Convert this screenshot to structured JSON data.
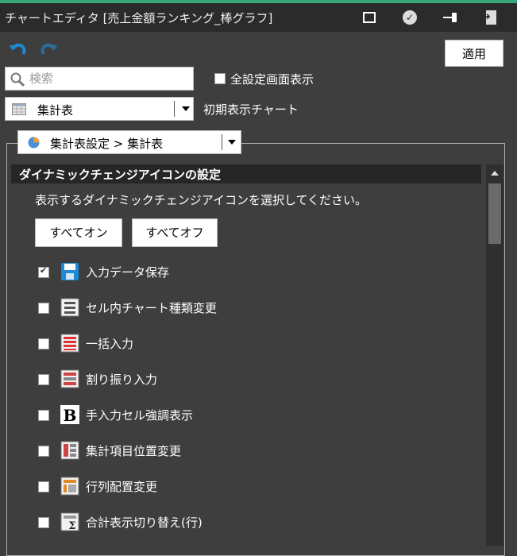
{
  "window": {
    "title": "チャートエディタ [売上金額ランキング_棒グラフ]"
  },
  "toolbar": {
    "apply_label": "適用"
  },
  "search": {
    "placeholder": "検索"
  },
  "full_settings": {
    "label": "全設定画面表示",
    "checked": false
  },
  "chart_select": {
    "value": "集計表",
    "label": "初期表示チャート"
  },
  "settings_select": {
    "value": "集計表設定 > 集計表"
  },
  "section": {
    "title": "ダイナミックチェンジアイコンの設定",
    "instruction": "表示するダイナミックチェンジアイコンを選択してください。",
    "all_on": "すべてオン",
    "all_off": "すべてオフ"
  },
  "items": [
    {
      "label": "入力データ保存",
      "checked": true,
      "icon": "floppy-disk-icon"
    },
    {
      "label": "セル内チャート種類変更",
      "checked": false,
      "icon": "cell-chart-icon"
    },
    {
      "label": "一括入力",
      "checked": false,
      "icon": "bulk-input-icon"
    },
    {
      "label": "割り振り入力",
      "checked": false,
      "icon": "allocate-input-icon"
    },
    {
      "label": "手入力セル強調表示",
      "checked": false,
      "icon": "bold-b-icon"
    },
    {
      "label": "集計項目位置変更",
      "checked": false,
      "icon": "item-position-icon"
    },
    {
      "label": "行列配置変更",
      "checked": false,
      "icon": "row-column-icon"
    },
    {
      "label": "合計表示切り替え(行)",
      "checked": false,
      "icon": "sum-toggle-icon"
    }
  ],
  "colors": {
    "background": "#3e3e3e",
    "titlebar": "#2b2b2b",
    "accent": "#3aa57a",
    "icon_blue": "#1e88d4"
  }
}
